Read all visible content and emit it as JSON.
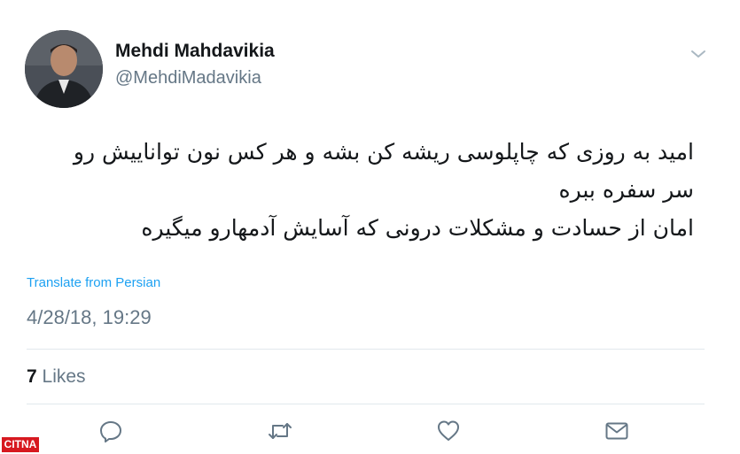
{
  "user": {
    "display_name": "Mehdi Mahdavikia",
    "handle": "@MehdiMadavikia",
    "avatar_icon": "profile-photo"
  },
  "tweet": {
    "lines": [
      "امید به روزی که چاپلوسی ریشه کن بشه و هر کس نون تواناییش رو",
      "سر سفره ببره",
      "امان از حسادت و مشکلات درونی که آسایش آدمهارو میگیره"
    ],
    "translate_label": "Translate from Persian",
    "timestamp": "4/28/18, 19:29"
  },
  "stats": {
    "likes_count": "7",
    "likes_label": "Likes"
  },
  "actions": [
    {
      "name": "reply",
      "icon": "reply-icon"
    },
    {
      "name": "retweet",
      "icon": "retweet-icon"
    },
    {
      "name": "like",
      "icon": "heart-icon"
    },
    {
      "name": "message",
      "icon": "mail-icon"
    }
  ],
  "watermark": {
    "text": "CITNA"
  },
  "colors": {
    "accent": "#1da1f2",
    "muted": "#657786",
    "text": "#14171a",
    "divider": "#e1e8ed",
    "watermark": "#d71920"
  }
}
